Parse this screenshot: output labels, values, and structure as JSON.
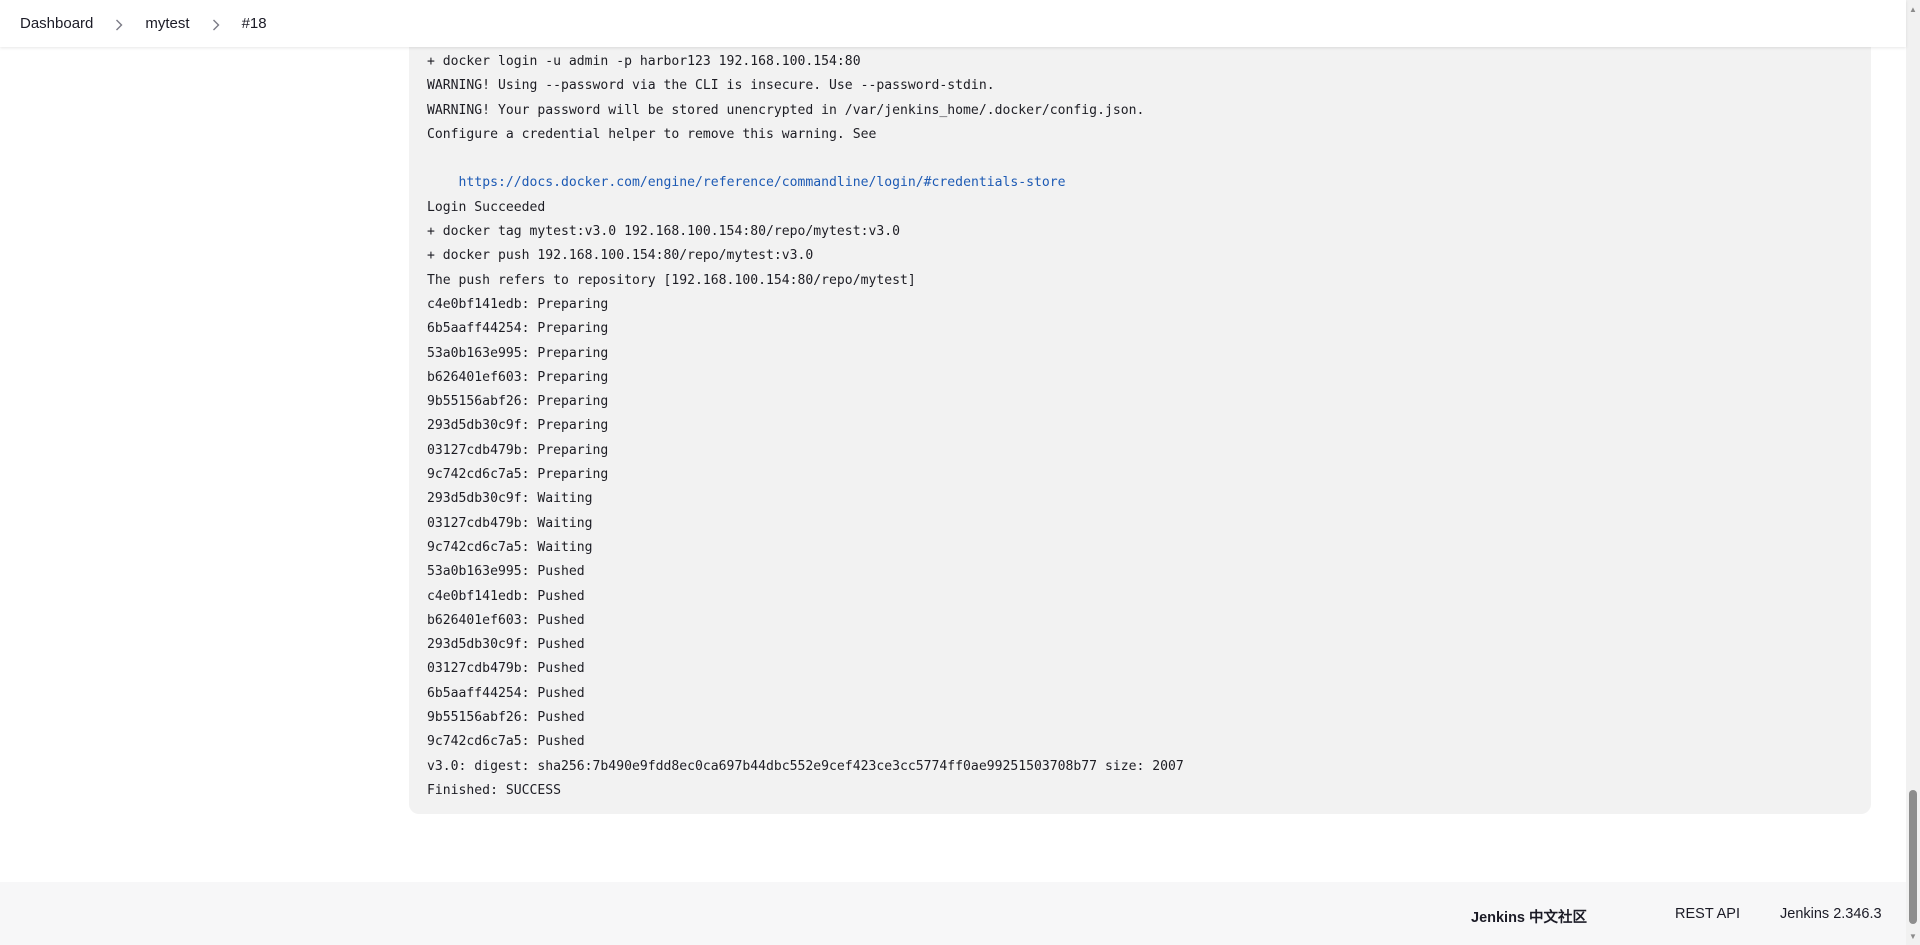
{
  "breadcrumb": {
    "items": [
      "Dashboard",
      "mytest",
      "#18"
    ]
  },
  "console": {
    "lines_before_link": [
      "+ docker login -u admin -p harbor123 192.168.100.154:80",
      "WARNING! Using --password via the CLI is insecure. Use --password-stdin.",
      "WARNING! Your password will be stored unencrypted in /var/jenkins_home/.docker/config.json.",
      "Configure a credential helper to remove this warning. See"
    ],
    "link": "https://docs.docker.com/engine/reference/commandline/login/#credentials-store",
    "lines_after_link": [
      "",
      "Login Succeeded",
      "+ docker tag mytest:v3.0 192.168.100.154:80/repo/mytest:v3.0",
      "+ docker push 192.168.100.154:80/repo/mytest:v3.0",
      "The push refers to repository [192.168.100.154:80/repo/mytest]",
      "c4e0bf141edb: Preparing",
      "6b5aaff44254: Preparing",
      "53a0b163e995: Preparing",
      "b626401ef603: Preparing",
      "9b55156abf26: Preparing",
      "293d5db30c9f: Preparing",
      "03127cdb479b: Preparing",
      "9c742cd6c7a5: Preparing",
      "293d5db30c9f: Waiting",
      "03127cdb479b: Waiting",
      "9c742cd6c7a5: Waiting",
      "53a0b163e995: Pushed",
      "c4e0bf141edb: Pushed",
      "b626401ef603: Pushed",
      "293d5db30c9f: Pushed",
      "03127cdb479b: Pushed",
      "6b5aaff44254: Pushed",
      "9b55156abf26: Pushed",
      "9c742cd6c7a5: Pushed",
      "v3.0: digest: sha256:7b490e9fdd8ec0ca697b44dbc552e9cef423ce3cc5774ff0ae99251503708b77 size: 2007",
      "Finished: SUCCESS"
    ]
  },
  "footer": {
    "community": "Jenkins 中文社区",
    "rest_api": "REST API",
    "version": "Jenkins 2.346.3"
  },
  "colors": {
    "link": "#1d5ab4",
    "console_bg": "#f2f2f2",
    "footer_bg": "#f7f7f8"
  }
}
